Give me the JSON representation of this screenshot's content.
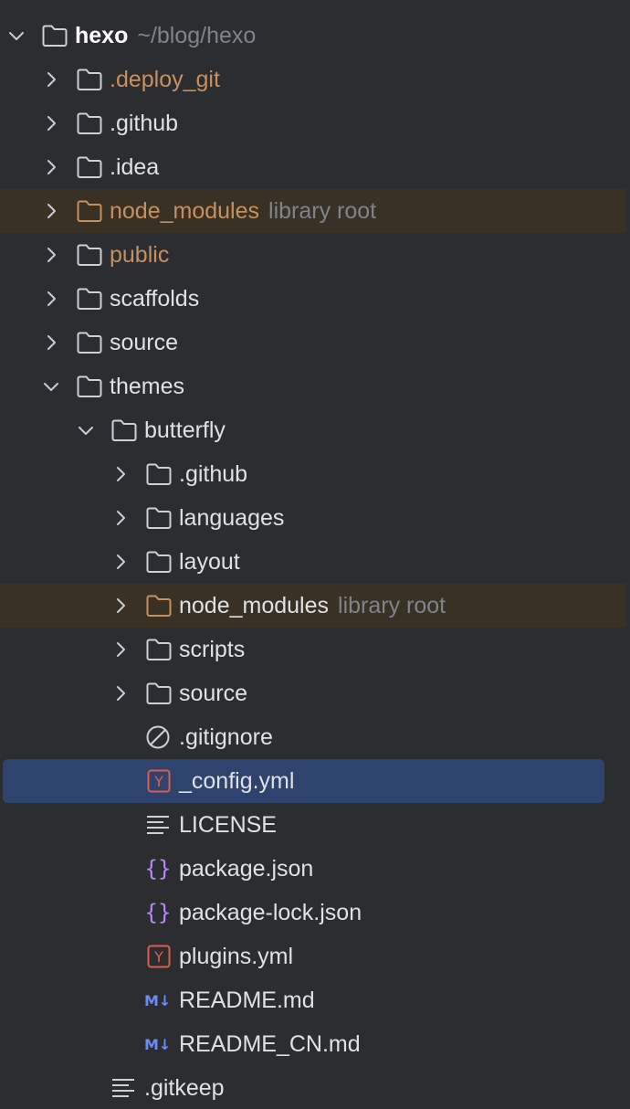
{
  "tree": {
    "root": {
      "name": "hexo",
      "path": "~/blog/hexo"
    },
    "items": [
      {
        "label": ".deploy_git",
        "excluded": true
      },
      {
        "label": ".github"
      },
      {
        "label": ".idea"
      },
      {
        "label": "node_modules",
        "hint": "library root",
        "excluded": true
      },
      {
        "label": "public",
        "excluded": true
      },
      {
        "label": "scaffolds"
      },
      {
        "label": "source"
      },
      {
        "label": "themes"
      },
      {
        "label": "butterfly"
      },
      {
        "label": ".github"
      },
      {
        "label": "languages"
      },
      {
        "label": "layout"
      },
      {
        "label": "node_modules",
        "hint": "library root"
      },
      {
        "label": "scripts"
      },
      {
        "label": "source"
      },
      {
        "label": ".gitignore"
      },
      {
        "label": "_config.yml",
        "selected": true
      },
      {
        "label": "LICENSE"
      },
      {
        "label": "package.json"
      },
      {
        "label": "package-lock.json"
      },
      {
        "label": "plugins.yml"
      },
      {
        "label": "README.md"
      },
      {
        "label": "README_CN.md"
      },
      {
        "label": ".gitkeep"
      }
    ]
  },
  "icons": {
    "chevron_right": "chevron-right-icon",
    "chevron_down": "chevron-down-icon",
    "folder": "folder-icon",
    "library_folder": "folder-library-icon",
    "gitignore": "ignore-file-icon",
    "yaml": "yaml-file-icon",
    "text": "text-file-icon",
    "json": "json-file-icon",
    "markdown": "markdown-file-icon",
    "markdown_text": "M↓",
    "yaml_text": "Y",
    "json_text": "{}"
  },
  "colors": {
    "background": "#2b2d30",
    "text": "#dfe1e5",
    "excluded_text": "#c8905e",
    "hint_text": "#7f838b",
    "selection": "#2e436e",
    "library_root_row": "#3a3125",
    "yaml_icon": "#d9604e",
    "json_icon": "#b589f3",
    "markdown_icon": "#6b8cf7"
  }
}
